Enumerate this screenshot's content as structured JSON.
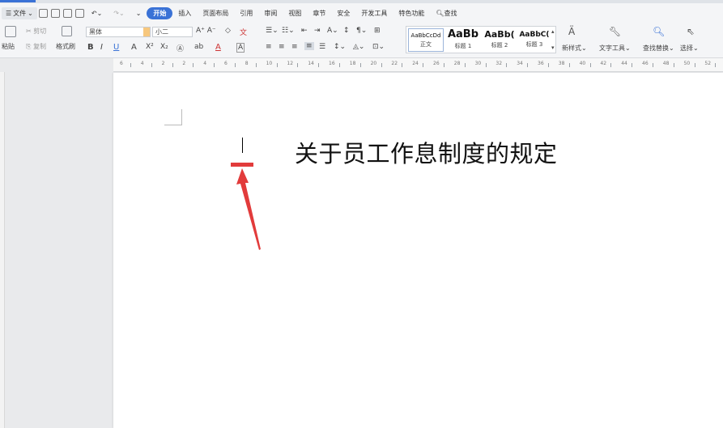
{
  "colors": {
    "accent": "#3a72d6",
    "marker": "#e23b3b"
  },
  "menubar": {
    "file_label": "文件",
    "active_tab": "开始",
    "tabs": [
      "插入",
      "页面布局",
      "引用",
      "审阅",
      "视图",
      "章节",
      "安全",
      "开发工具",
      "特色功能"
    ],
    "search_label": "查找"
  },
  "ribbon": {
    "paste_label": "粘贴",
    "cut_label": "剪切",
    "copy_label": "复制",
    "format_painter_label": "格式刷",
    "font_name": "黑体",
    "font_size": "小二",
    "styles": [
      {
        "preview": "AaBbCcDd",
        "name": "正文"
      },
      {
        "preview": "AaBb",
        "name": "标题 1"
      },
      {
        "preview": "AaBb(",
        "name": "标题 2"
      },
      {
        "preview": "AaBbC(",
        "name": "标题 3"
      }
    ],
    "new_style_label": "新样式",
    "text_tools_label": "文字工具",
    "find_replace_label": "查找替换",
    "select_label": "选择"
  },
  "ruler": {
    "numbers": [
      "6",
      "4",
      "2",
      "2",
      "4",
      "6",
      "8",
      "10",
      "12",
      "14",
      "16",
      "18",
      "20",
      "22",
      "24",
      "26",
      "28",
      "30",
      "32",
      "34",
      "36",
      "38",
      "40",
      "42",
      "44",
      "46",
      "48",
      "50",
      "52"
    ]
  },
  "document": {
    "title": "关于员工作息制度的规定"
  }
}
